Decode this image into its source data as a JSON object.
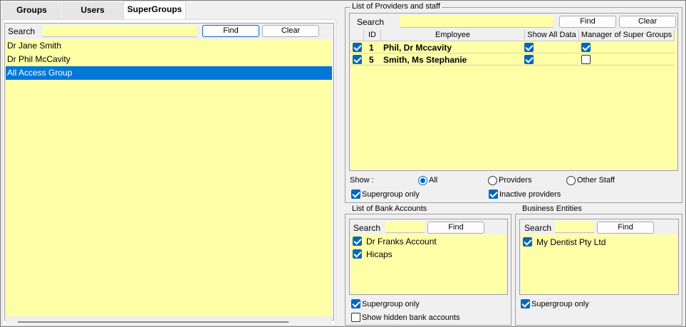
{
  "tabs": [
    {
      "label": "Groups"
    },
    {
      "label": "Users"
    },
    {
      "label": "SuperGroups"
    }
  ],
  "left": {
    "search_label": "Search",
    "search_value": "",
    "find_label": "Find",
    "clear_label": "Clear",
    "items": [
      {
        "label": "Dr Jane Smith"
      },
      {
        "label": "Dr Phil McCavity"
      },
      {
        "label": "All Access Group"
      }
    ],
    "selected_index": 2
  },
  "providers": {
    "title": "List of Providers and staff",
    "search_label": "Search",
    "search_value": "",
    "find_label": "Find",
    "clear_label": "Clear",
    "columns": [
      "ID",
      "Employee",
      "Show All Data",
      "Manager of Super Groups"
    ],
    "rows": [
      {
        "checked": true,
        "id": "1",
        "employee": "Phil, Dr Mccavity",
        "show_all": true,
        "manager": true
      },
      {
        "checked": true,
        "id": "5",
        "employee": "Smith, Ms Stephanie",
        "show_all": true,
        "manager": false
      }
    ],
    "show_label": "Show :",
    "show_options": [
      {
        "label": "All",
        "selected": true
      },
      {
        "label": "Providers",
        "selected": false
      },
      {
        "label": "Other Staff",
        "selected": false
      }
    ],
    "supergroup_only_label": "Supergroup only",
    "supergroup_only": true,
    "inactive_label": "Inactive providers",
    "inactive": true
  },
  "bank": {
    "title": "List of Bank Accounts",
    "search_label": "Search",
    "find_label": "Find",
    "items": [
      {
        "label": "Dr Franks Account",
        "checked": true
      },
      {
        "label": "Hicaps",
        "checked": true
      }
    ],
    "supergroup_only_label": "Supergroup only",
    "supergroup_only": true,
    "hidden_label": "Show hidden bank accounts",
    "hidden": false
  },
  "business": {
    "title": "Business Entities",
    "search_label": "Search",
    "find_label": "Find",
    "items": [
      {
        "label": "My Dentist Pty Ltd",
        "checked": true
      }
    ],
    "supergroup_only_label": "Supergroup only",
    "supergroup_only": true
  },
  "colors": {
    "panel_yellow": "#ffffa8",
    "selection_blue": "#0078d7",
    "check_blue": "#0067c0"
  }
}
